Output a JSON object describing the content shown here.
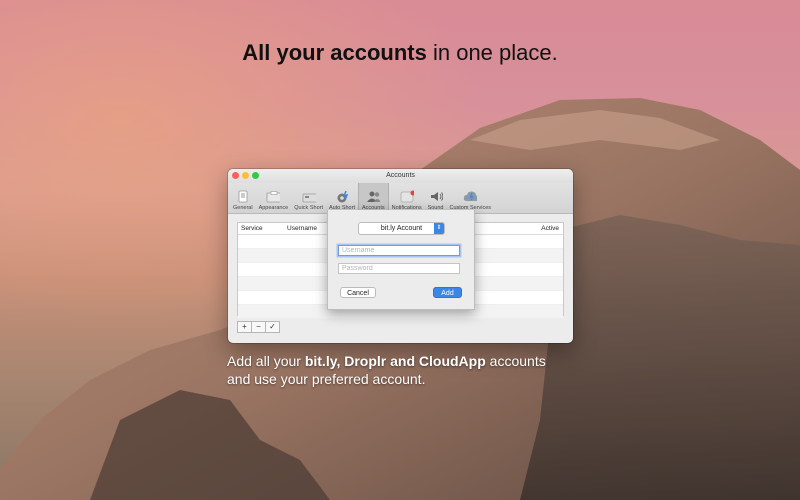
{
  "headline": {
    "bold": "All your accounts",
    "rest": " in one place."
  },
  "window": {
    "title": "Accounts",
    "traffic_colors": [
      "#fc605c",
      "#fdbc40",
      "#34c84a"
    ],
    "toolbar": [
      {
        "label": "General",
        "icon": "general-icon"
      },
      {
        "label": "Appearance",
        "icon": "appearance-icon"
      },
      {
        "label": "Quick Short",
        "icon": "quick-short-icon"
      },
      {
        "label": "Auto Short",
        "icon": "auto-short-icon"
      },
      {
        "label": "Accounts",
        "icon": "accounts-icon",
        "active": true
      },
      {
        "label": "Notifications",
        "icon": "notifications-icon"
      },
      {
        "label": "Sound",
        "icon": "sound-icon"
      },
      {
        "label": "Custom Services",
        "icon": "custom-services-icon"
      }
    ],
    "table": {
      "columns": [
        "Service",
        "Username",
        "Active"
      ]
    },
    "buttons": {
      "add": "+",
      "remove": "−",
      "check": "✓"
    }
  },
  "sheet": {
    "service_select": "bit.ly Account",
    "username_placeholder": "Username",
    "password_placeholder": "Password",
    "cancel": "Cancel",
    "add": "Add",
    "accent": "#3b87e6"
  },
  "caption": {
    "line1_pre": "Add all your ",
    "line1_bold": "bit.ly, Droplr and CloudApp",
    "line1_post": " accounts",
    "line2": "and use your preferred account."
  }
}
